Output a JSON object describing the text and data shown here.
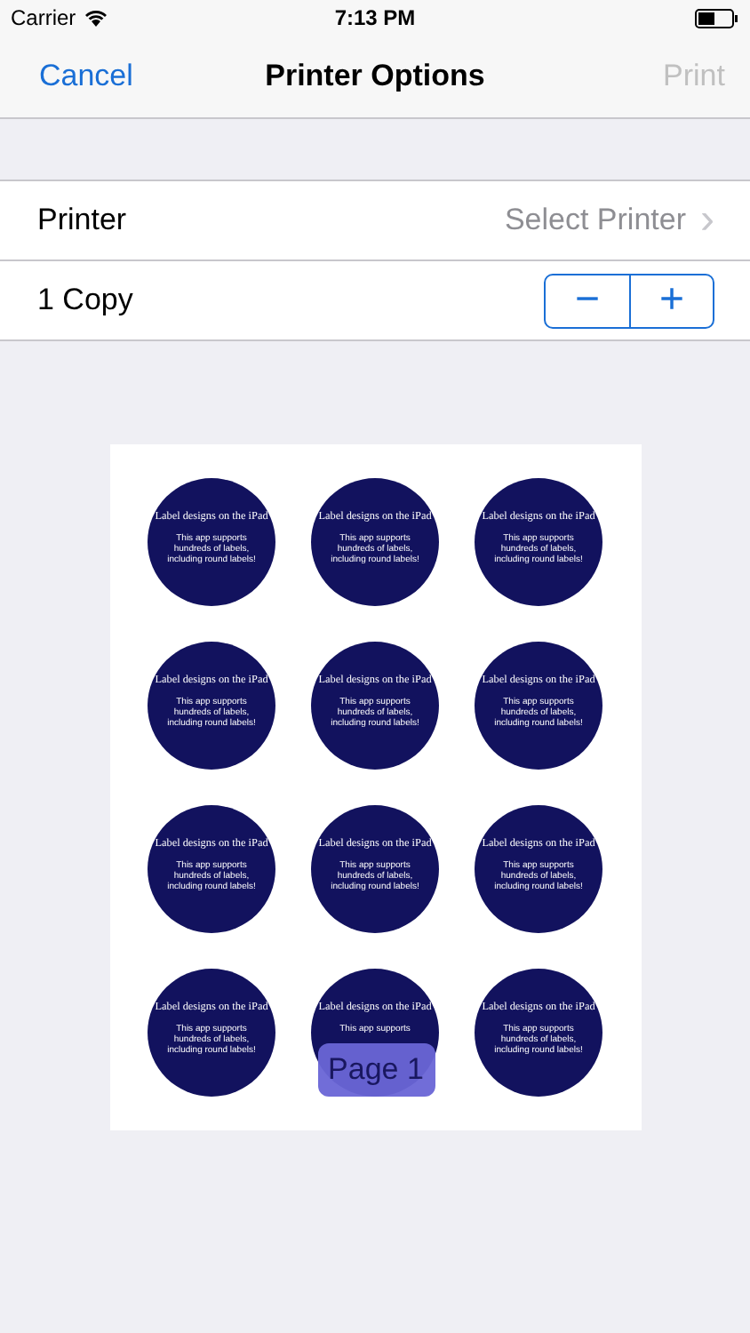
{
  "status_bar": {
    "carrier": "Carrier",
    "time": "7:13 PM"
  },
  "nav": {
    "cancel": "Cancel",
    "title": "Printer Options",
    "print": "Print",
    "print_disabled": true
  },
  "printer_row": {
    "label": "Printer",
    "value": "Select Printer",
    "chevron": "›"
  },
  "copies_row": {
    "label": "1 Copy",
    "minus": "−",
    "plus": "+"
  },
  "preview": {
    "labels": [
      {
        "title": "Label designs on the iPad",
        "body": [
          "This app supports",
          "hundreds of labels,",
          "including round labels!"
        ]
      },
      {
        "title": "Label designs on the iPad",
        "body": [
          "This app supports",
          "hundreds of labels,",
          "including round labels!"
        ]
      },
      {
        "title": "Label designs on the iPad",
        "body": [
          "This app supports",
          "hundreds of labels,",
          "including round labels!"
        ]
      },
      {
        "title": "Label designs on the iPad",
        "body": [
          "This app supports",
          "hundreds of labels,",
          "including round labels!"
        ]
      },
      {
        "title": "Label designs on the iPad",
        "body": [
          "This app supports",
          "hundreds of labels,",
          "including round labels!"
        ]
      },
      {
        "title": "Label designs on the iPad",
        "body": [
          "This app supports",
          "hundreds of labels,",
          "including round labels!"
        ]
      },
      {
        "title": "Label designs on the iPad",
        "body": [
          "This app supports",
          "hundreds of labels,",
          "including round labels!"
        ]
      },
      {
        "title": "Label designs on the iPad",
        "body": [
          "This app supports",
          "hundreds of labels,",
          "including round labels!"
        ]
      },
      {
        "title": "Label designs on the iPad",
        "body": [
          "This app supports",
          "hundreds of labels,",
          "including round labels!"
        ]
      },
      {
        "title": "Label designs on the iPad",
        "body": [
          "This app supports",
          "hundreds of labels,",
          "including round labels!"
        ]
      },
      {
        "title": "Label designs on the iPad",
        "body": [
          "This app supports"
        ]
      },
      {
        "title": "Label designs on the iPad",
        "body": [
          "This app supports",
          "hundreds of labels,",
          "including round labels!"
        ]
      }
    ],
    "page_badge": "Page 1"
  }
}
